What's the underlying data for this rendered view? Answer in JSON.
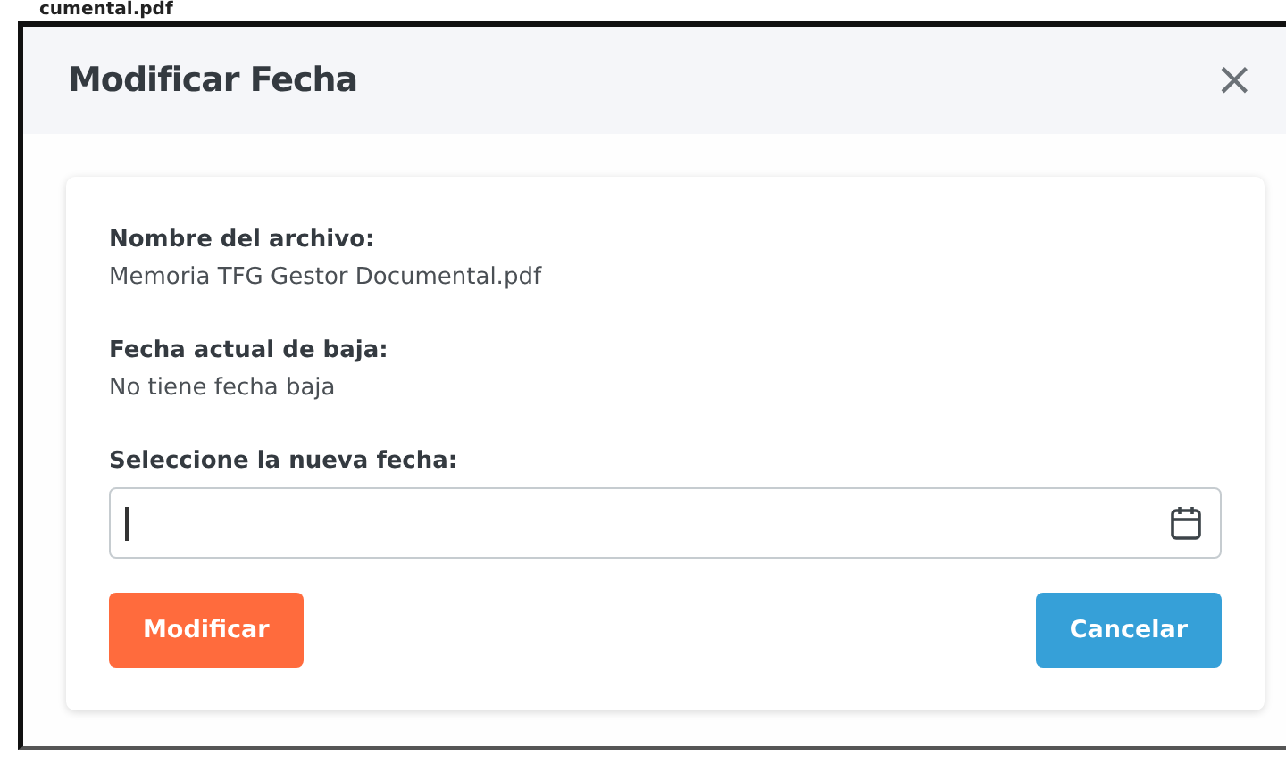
{
  "background_text": "cumental.pdf",
  "dialog": {
    "title": "Modificar Fecha",
    "close": "×"
  },
  "fields": [
    {
      "label": "Nombre del archivo:",
      "value": "Memoria TFG Gestor Documental.pdf"
    },
    {
      "label": "Fecha actual de baja:",
      "value": "No tiene fecha baja"
    }
  ],
  "date_input": {
    "label": "Seleccione la nueva fecha:",
    "focused": true
  },
  "buttons": [
    {
      "label": "Modificar",
      "kind": "primary"
    },
    {
      "label": "Cancelar",
      "kind": "secondary"
    }
  ]
}
